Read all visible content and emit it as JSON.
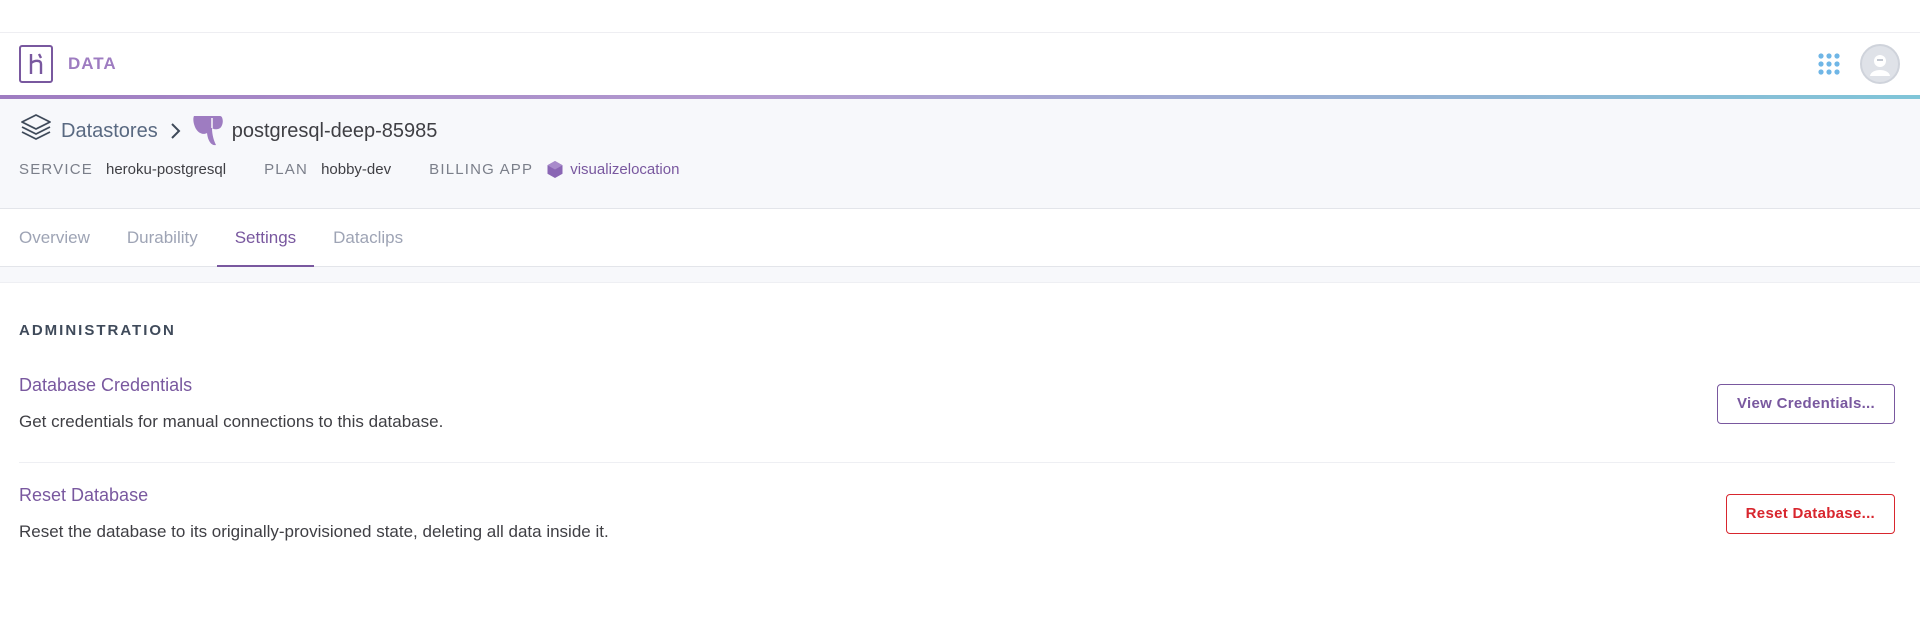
{
  "header": {
    "brand_label": "DATA",
    "icons": {
      "logo": "heroku-logo-icon",
      "apps": "grid-apps-icon",
      "avatar": "user-avatar-icon"
    },
    "colors": {
      "brand": "#79589f",
      "brand_light": "#9e7cc1",
      "accent_teal": "#7fc5d8"
    }
  },
  "breadcrumb": {
    "root_label": "Datastores",
    "root_icon": "stacked-layers-icon",
    "separator_icon": "chevron-right-icon",
    "db_icon": "postgres-icon",
    "db_name": "postgresql-deep-85985"
  },
  "meta": {
    "service_label": "SERVICE",
    "service_value": "heroku-postgresql",
    "plan_label": "PLAN",
    "plan_value": "hobby-dev",
    "billing_label": "BILLING APP",
    "billing_value": "visualizelocation",
    "billing_icon": "hexagon-app-icon"
  },
  "tabs": [
    {
      "label": "Overview",
      "active": false
    },
    {
      "label": "Durability",
      "active": false
    },
    {
      "label": "Settings",
      "active": true
    },
    {
      "label": "Dataclips",
      "active": false
    }
  ],
  "administration": {
    "section_title": "ADMINISTRATION",
    "credentials": {
      "title": "Database Credentials",
      "description": "Get credentials for manual connections to this database.",
      "button": "View Credentials..."
    },
    "reset": {
      "title": "Reset Database",
      "description": "Reset the database to its originally-provisioned state, deleting all data inside it.",
      "button": "Reset Database..."
    }
  },
  "colors": {
    "danger": "#d8262e",
    "link": "#79589f"
  }
}
